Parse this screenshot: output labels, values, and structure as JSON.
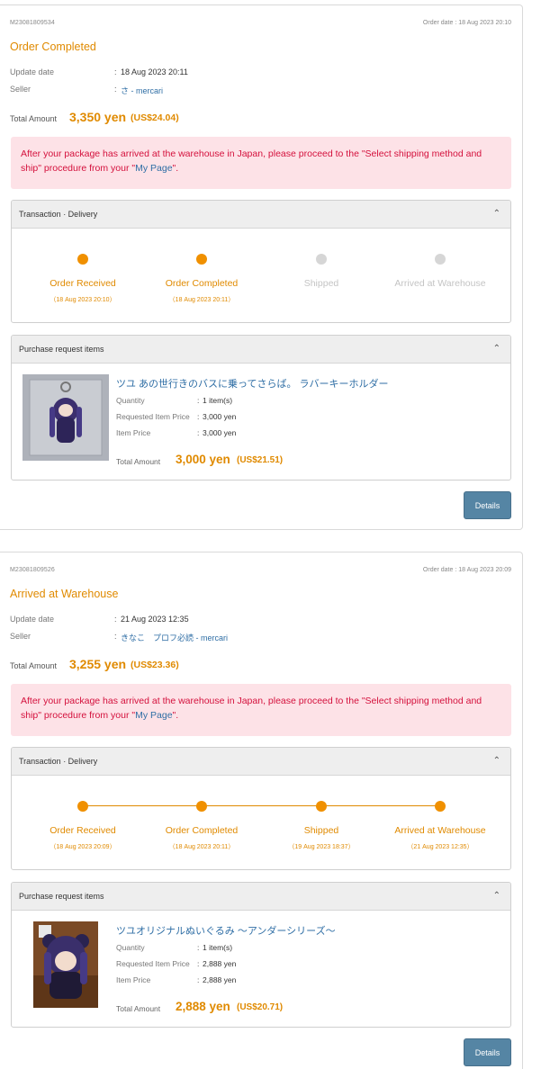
{
  "labels": {
    "order_date_prefix": "Order date : ",
    "update_date": "Update date",
    "seller": "Seller",
    "colon": ":",
    "total_amount": "Total Amount",
    "alert_before": "After your package has arrived at the warehouse in Japan, please proceed to the \"Select shipping method and ship\" procedure from your \"",
    "alert_link": "My Page",
    "alert_after": "\".",
    "delivery_panel": "Transaction · Delivery",
    "items_panel": "Purchase request items",
    "quantity": "Quantity",
    "requested_item_price": "Requested Item Price",
    "item_price": "Item Price",
    "details_button": "Details"
  },
  "steps": [
    "Order Received",
    "Order Completed",
    "Shipped",
    "Arrived at Warehouse"
  ],
  "orders": [
    {
      "id": "M23081809534",
      "order_date": "18 Aug 2023 20:10",
      "status": "Order Completed",
      "update_date": "18 Aug 2023 20:11",
      "seller": "さ - mercari",
      "total_yen": "3,350 yen",
      "total_usd": "(US$24.04)",
      "step_dates": [
        "（18 Aug 2023 20:10）",
        "（18 Aug 2023 20:11）",
        "",
        ""
      ],
      "steps_completed": 2,
      "item": {
        "title": "ツユ あの世行きのバスに乗ってさらば。 ラバーキーホルダー",
        "quantity": "1 item(s)",
        "requested_price": "3,000 yen",
        "item_price": "3,000 yen",
        "total_yen": "3,000 yen",
        "total_usd": "(US$21.51)"
      }
    },
    {
      "id": "M23081809526",
      "order_date": "18 Aug 2023 20:09",
      "status": "Arrived at Warehouse",
      "update_date": "21 Aug 2023 12:35",
      "seller": "きなこ　プロフ必読 - mercari",
      "total_yen": "3,255 yen",
      "total_usd": "(US$23.36)",
      "step_dates": [
        "（18 Aug 2023 20:09）",
        "（18 Aug 2023 20:11）",
        "（19 Aug 2023 18:37）",
        "（21 Aug 2023 12:35）"
      ],
      "steps_completed": 4,
      "item": {
        "title": "ツユオリジナルぬいぐるみ 〜アンダーシリーズ〜",
        "quantity": "1 item(s)",
        "requested_price": "2,888 yen",
        "item_price": "2,888 yen",
        "total_yen": "2,888 yen",
        "total_usd": "(US$20.71)"
      }
    }
  ],
  "colors": {
    "accent": "#e08a00",
    "link": "#2f6ea5",
    "alert_bg": "#fde2e7",
    "alert_text": "#d4103c",
    "button": "#5585a4"
  }
}
